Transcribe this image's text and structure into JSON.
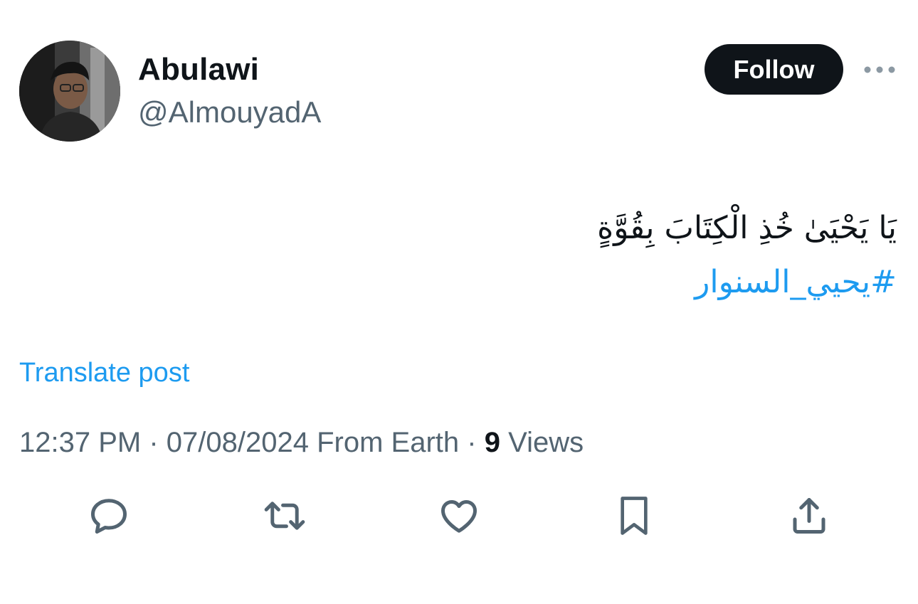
{
  "author": {
    "display_name": "Abulawi",
    "handle": "@AlmouyadA"
  },
  "follow_label": "Follow",
  "more_icon": "more-horizontal-icon",
  "tweet": {
    "text": "يَا يَحْيَىٰ خُذِ الْكِتَابَ بِقُوَّةٍ",
    "hashtag": "#يحيي_السنوار"
  },
  "translate_label": "Translate post",
  "meta": {
    "time": "12:37 PM",
    "separator": "·",
    "date": "07/08/2024",
    "source": "From Earth",
    "views_count": "9",
    "views_label": "Views"
  },
  "actions": [
    "reply-icon",
    "repost-icon",
    "like-icon",
    "bookmark-icon",
    "share-icon"
  ],
  "colors": {
    "text_primary": "#0f1419",
    "text_secondary": "#536471",
    "link": "#1d9bf0",
    "icon": "#536471",
    "button_bg": "#0f1419"
  }
}
